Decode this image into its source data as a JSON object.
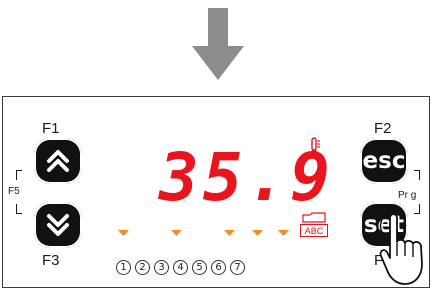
{
  "transition_icon": "down-arrow-icon",
  "panel": {
    "keys": {
      "f1": "F1",
      "f2": "F2",
      "f3": "F3",
      "f4": "F4",
      "f5": "F5",
      "prg": "Pr g"
    },
    "buttons": {
      "up": {
        "icon": "double-chevron-up-icon"
      },
      "down": {
        "icon": "double-chevron-down-icon"
      },
      "esc": {
        "label": "esc"
      },
      "set": {
        "label": "set"
      }
    },
    "display": {
      "value": "35.9",
      "abc": "ABC",
      "thermometer_icon": "thermometer-icon",
      "folder_icon": "folder-icon"
    },
    "indicators": [
      "1",
      "2",
      "3",
      "4",
      "5",
      "6",
      "7"
    ],
    "led_color": "#f28c28",
    "display_color": "#e8141e"
  }
}
